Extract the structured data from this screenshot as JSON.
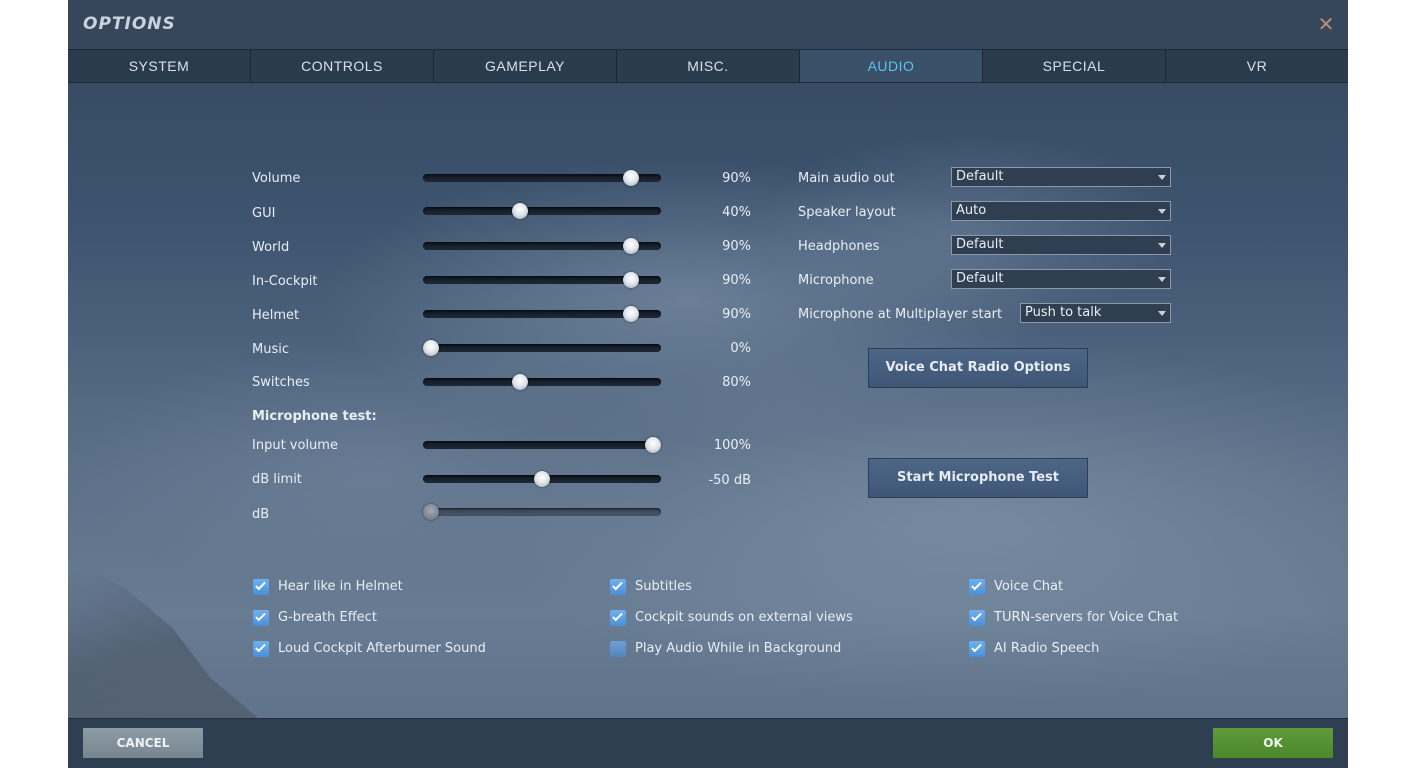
{
  "window": {
    "title": "OPTIONS"
  },
  "tabs": [
    {
      "label": "SYSTEM",
      "active": false
    },
    {
      "label": "CONTROLS",
      "active": false
    },
    {
      "label": "GAMEPLAY",
      "active": false
    },
    {
      "label": "MISC.",
      "active": false
    },
    {
      "label": "AUDIO",
      "active": true
    },
    {
      "label": "SPECIAL",
      "active": false
    },
    {
      "label": "VR",
      "active": false
    }
  ],
  "sliders": [
    {
      "label": "Volume",
      "value_text": "90%",
      "level": 0.9,
      "enabled": true
    },
    {
      "label": "GUI",
      "value_text": "40%",
      "level": 0.4,
      "enabled": true
    },
    {
      "label": "World",
      "value_text": "90%",
      "level": 0.9,
      "enabled": true
    },
    {
      "label": "In-Cockpit",
      "value_text": "90%",
      "level": 0.9,
      "enabled": true
    },
    {
      "label": "Helmet",
      "value_text": "90%",
      "level": 0.9,
      "enabled": true
    },
    {
      "label": "Music",
      "value_text": "0%",
      "level": 0.0,
      "enabled": true
    },
    {
      "label": "Switches",
      "value_text": "80%",
      "level": 0.4,
      "enabled": true
    }
  ],
  "mic_test": {
    "heading": "Microphone test:",
    "sliders": [
      {
        "label": "Input volume",
        "value_text": "100%",
        "level": 1.0,
        "enabled": true
      },
      {
        "label": "dB limit",
        "value_text": "-50 dB",
        "level": 0.5,
        "enabled": true
      },
      {
        "label": "dB",
        "value_text": "",
        "level": 0.0,
        "enabled": false
      }
    ]
  },
  "dropdowns": [
    {
      "label": "Main audio out",
      "value": "Default"
    },
    {
      "label": "Speaker layout",
      "value": "Auto"
    },
    {
      "label": "Headphones",
      "value": "Default"
    },
    {
      "label": "Microphone",
      "value": "Default"
    },
    {
      "label": "Microphone at Multiplayer start",
      "value": "Push to talk"
    }
  ],
  "buttons": {
    "voice_chat_radio_options": "Voice Chat Radio Options",
    "start_microphone_test": "Start Microphone Test",
    "cancel": "CANCEL",
    "ok": "OK"
  },
  "checkboxes": [
    {
      "label": "Hear like in Helmet",
      "checked": true
    },
    {
      "label": "G-breath Effect",
      "checked": true
    },
    {
      "label": "Loud Cockpit Afterburner Sound",
      "checked": true
    },
    {
      "label": "Subtitles",
      "checked": true
    },
    {
      "label": "Cockpit sounds on external views",
      "checked": true
    },
    {
      "label": "Play Audio While in Background",
      "checked": false
    },
    {
      "label": "Voice Chat",
      "checked": true
    },
    {
      "label": "TURN-servers for Voice Chat",
      "checked": true
    },
    {
      "label": "AI Radio Speech",
      "checked": true
    }
  ],
  "colors": {
    "active_tab": "#5ec4ef",
    "ok_button": "#5a9438",
    "cancel_button": "#86949e",
    "checkbox": "#5a9ee3",
    "close_icon": "#b98e78"
  },
  "icons": {
    "close": "close-icon",
    "dropdown_arrow": "chevron-down-icon",
    "checkbox_tick": "checkmark-icon"
  }
}
